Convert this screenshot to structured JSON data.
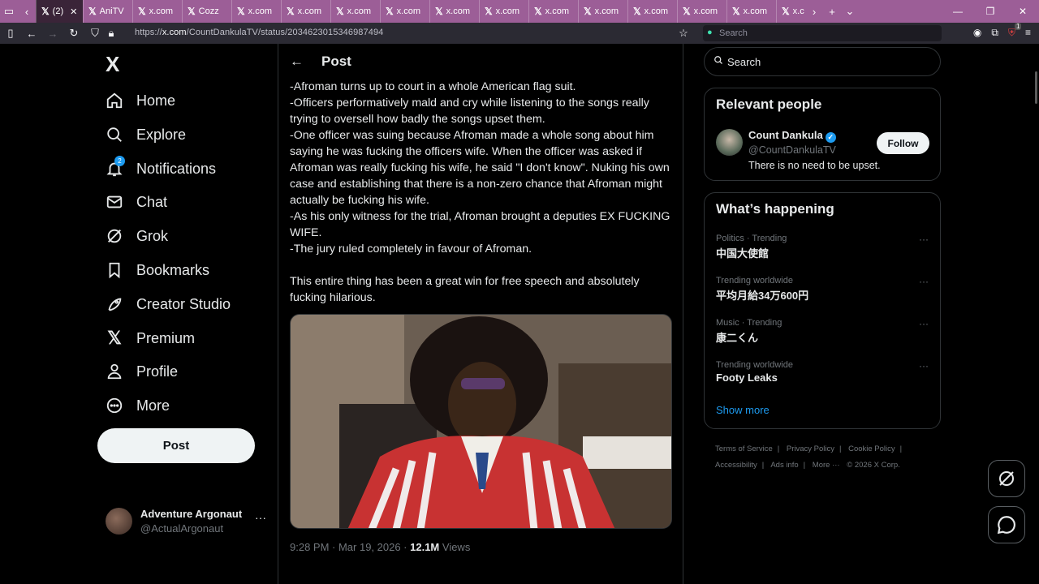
{
  "browser": {
    "tabs": [
      {
        "label": "(2)",
        "active": true
      },
      {
        "label": "AniTV"
      },
      {
        "label": "x.com"
      },
      {
        "label": "Cozz"
      },
      {
        "label": "x.com"
      },
      {
        "label": "x.com"
      },
      {
        "label": "x.com"
      },
      {
        "label": "x.com"
      },
      {
        "label": "x.com"
      },
      {
        "label": "x.com"
      },
      {
        "label": "x.com"
      },
      {
        "label": "x.com"
      },
      {
        "label": "x.com"
      },
      {
        "label": "x.com"
      },
      {
        "label": "x.com"
      },
      {
        "label": "x.c"
      }
    ],
    "url_prefix": "https://",
    "url_domain": "x.com",
    "url_path": "/CountDankulaTV/status/2034623015346987494",
    "search_placeholder": "Search",
    "ext_badge": "1"
  },
  "nav": {
    "logo": "X",
    "items": [
      "Home",
      "Explore",
      "Notifications",
      "Chat",
      "Grok",
      "Bookmarks",
      "Creator Studio",
      "Premium",
      "Profile",
      "More"
    ],
    "notif_count": "2",
    "post_label": "Post"
  },
  "account": {
    "name": "Adventure Argonaut",
    "handle": "@ActualArgonaut",
    "menu": "···"
  },
  "post": {
    "header": "Post",
    "lines": [
      "-Afroman turns up to court in a whole American flag suit.",
      "-Officers performatively mald and cry while listening to the songs really trying to oversell how badly the songs upset them.",
      "-One officer was suing because Afroman made a whole song about him saying he was fucking the officers wife. When the officer was asked if Afroman was really fucking his wife, he said \"I don't know\". Nuking his own case and establishing that there is a non-zero chance that Afroman might actually be fucking his wife.",
      "-As his only witness for the trial, Afroman brought a deputies EX FUCKING WIFE.",
      "-The jury ruled completely in favour of Afroman."
    ],
    "closing": "This entire thing has been a great win for free speech and absolutely fucking hilarious.",
    "time": "9:28 PM · Mar 19, 2026 · ",
    "views_count": "12.1M",
    "views_label": " Views"
  },
  "sidebar": {
    "search_placeholder": "Search",
    "relevant_title": "Relevant people",
    "person": {
      "name": "Count Dankula",
      "handle": "@CountDankulaTV",
      "bio": "There is no need to be upset.",
      "follow": "Follow"
    },
    "happening_title": "What’s happening",
    "trends": [
      {
        "context": "Politics · Trending",
        "title": "中国大使館"
      },
      {
        "context": "Trending worldwide",
        "title": "平均月給34万600円"
      },
      {
        "context": "Music · Trending",
        "title": "康二くん"
      },
      {
        "context": "Trending worldwide",
        "title": "Footy Leaks"
      }
    ],
    "show_more": "Show more",
    "footer_links": [
      "Terms of Service",
      "Privacy Policy",
      "Cookie Policy",
      "Accessibility",
      "Ads info",
      "More ···",
      "© 2026 X Corp."
    ]
  },
  "colors": {
    "accent": "#1d9bf0",
    "tabbar": "#9c5e97",
    "background": "#000000"
  }
}
